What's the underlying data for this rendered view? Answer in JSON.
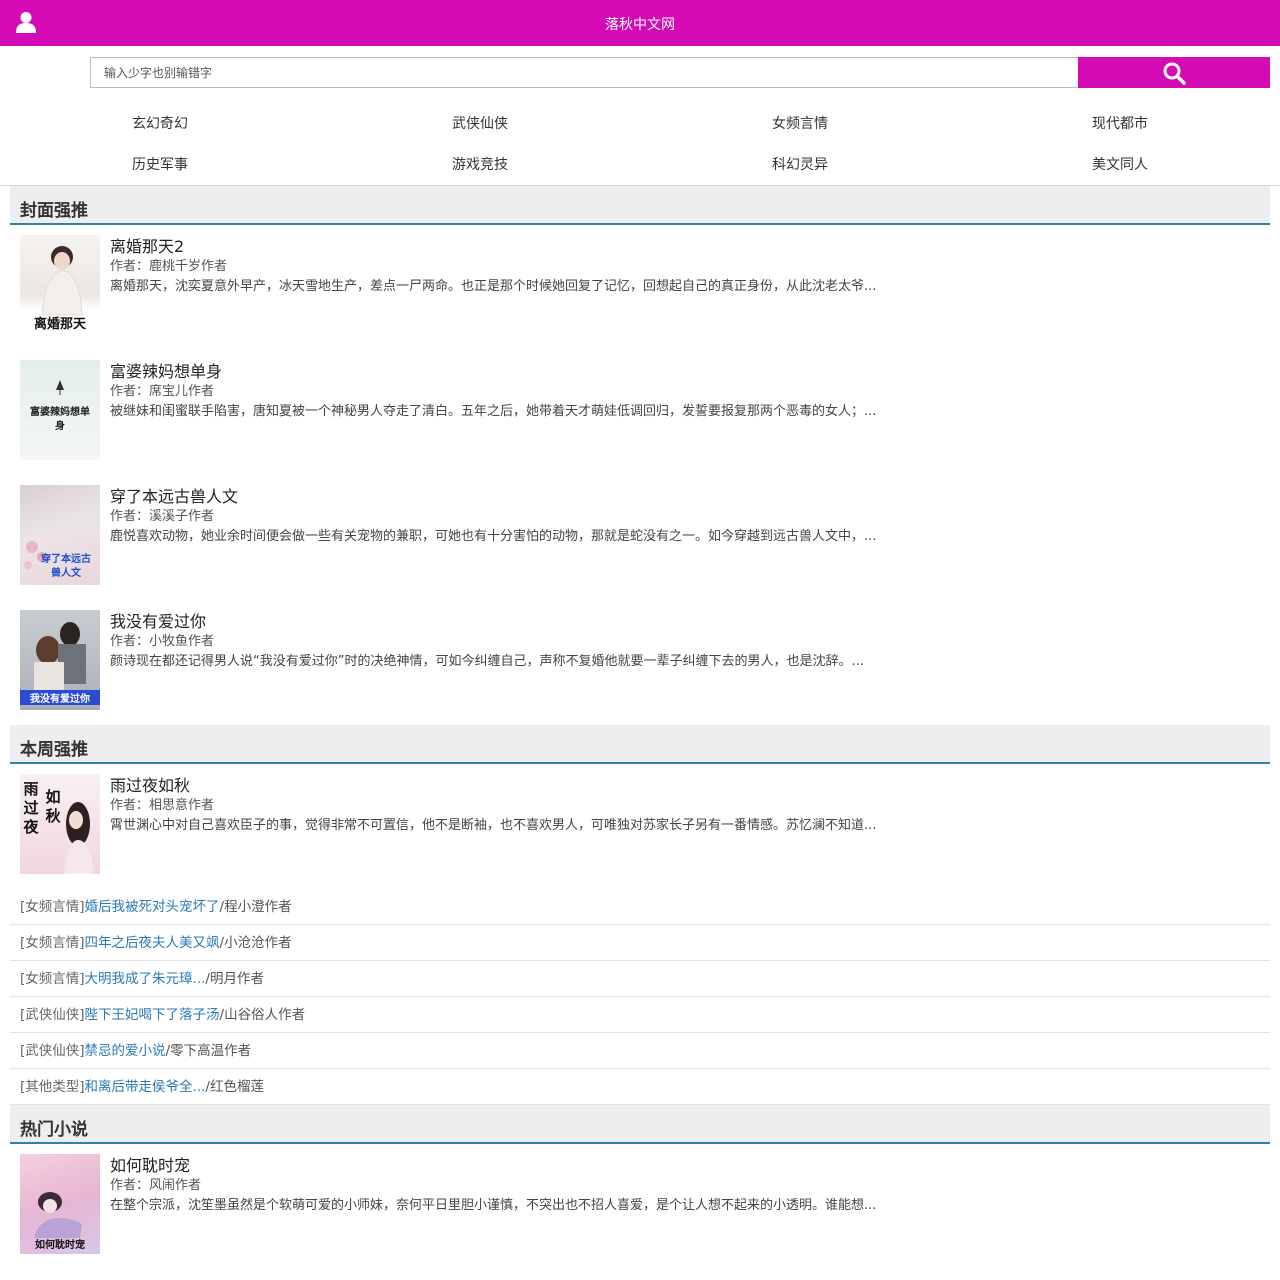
{
  "header": {
    "site_title": "落秋中文网",
    "user_icon": "user-icon"
  },
  "search": {
    "placeholder": "输入少字也别输错字",
    "button_icon": "search-icon"
  },
  "categories": [
    "玄幻奇幻",
    "武侠仙侠",
    "女频言情",
    "现代都市",
    "历史军事",
    "游戏竞技",
    "科幻灵异",
    "美文同人"
  ],
  "sections": {
    "cover_recommend": {
      "title": "封面强推",
      "books": [
        {
          "title": "离婚那天2",
          "author": "作者：鹿桃千岁作者",
          "intro": "离婚那天，沈奕夏意外早产，冰天雪地生产，差点一尸两命。也正是那个时候她回复了记忆，回想起自己的真正身份，从此沈老太爷...",
          "cover_text": "离婚那天"
        },
        {
          "title": "富婆辣妈想单身",
          "author": "作者：席宝儿作者",
          "intro": "被继妹和闺蜜联手陷害，唐知夏被一个神秘男人夺走了清白。五年之后，她带着天才萌娃低调回归，发誓要报复那两个恶毒的女人；...",
          "cover_text": "富婆辣妈想单身"
        },
        {
          "title": "穿了本远古兽人文",
          "author": "作者：溪溪子作者",
          "intro": "鹿悦喜欢动物，她业余时间便会做一些有关宠物的兼职，可她也有十分害怕的动物，那就是蛇没有之一。如今穿越到远古兽人文中，...",
          "cover_text": "穿了本远古兽人文"
        },
        {
          "title": "我没有爱过你",
          "author": "作者：小牧鱼作者",
          "intro": "颜诗现在都还记得男人说“我没有爱过你”时的决绝神情，可如今纠缠自己，声称不复婚他就要一辈子纠缠下去的男人，也是沈辞。...",
          "cover_text": "我没有爱过你"
        }
      ]
    },
    "weekly_recommend": {
      "title": "本周强推",
      "featured": {
        "title": "雨过夜如秋",
        "author": "作者：相思意作者",
        "intro": "霄世渊心中对自己喜欢臣子的事，觉得非常不可置信，他不是断袖，也不喜欢男人，可唯独对苏家长子另有一番情感。苏忆澜不知道...",
        "cover_text_a": "雨过夜",
        "cover_text_b": "如秋"
      },
      "list": [
        {
          "category": "[女频言情]",
          "title": "婚后我被死对头宠坏了",
          "slash": "/",
          "author": "程小澄作者"
        },
        {
          "category": "[女频言情]",
          "title": "四年之后夜夫人美又飒",
          "slash": "/",
          "author": "小沧沧作者"
        },
        {
          "category": "[女频言情]",
          "title": "大明我成了朱元璋...",
          "slash": "/",
          "author": "明月作者"
        },
        {
          "category": "[武侠仙侠]",
          "title": "陛下王妃喝下了落子汤",
          "slash": "/",
          "author": "山谷俗人作者"
        },
        {
          "category": "[武侠仙侠]",
          "title": "禁忌的爱小说",
          "slash": "/",
          "author": "零下高温作者"
        },
        {
          "category": "[其他类型]",
          "title": "和离后带走侯爷全...",
          "slash": "/",
          "author": "红色榴莲"
        }
      ]
    },
    "hot_novels": {
      "title": "热门小说",
      "books": [
        {
          "title": "如何耽时宠",
          "author": "作者：风闹作者",
          "intro": "在整个宗派，沈笙墨虽然是个软萌可爱的小师妹，奈何平日里胆小谨慎，不突出也不招人喜爱，是个让人想不起来的小透明。谁能想...",
          "cover_text": "如何耽时宠"
        }
      ]
    }
  },
  "colors": {
    "brand": "#d40ab5",
    "section_line": "#2f7fb3",
    "link": "#2a7ab6"
  }
}
